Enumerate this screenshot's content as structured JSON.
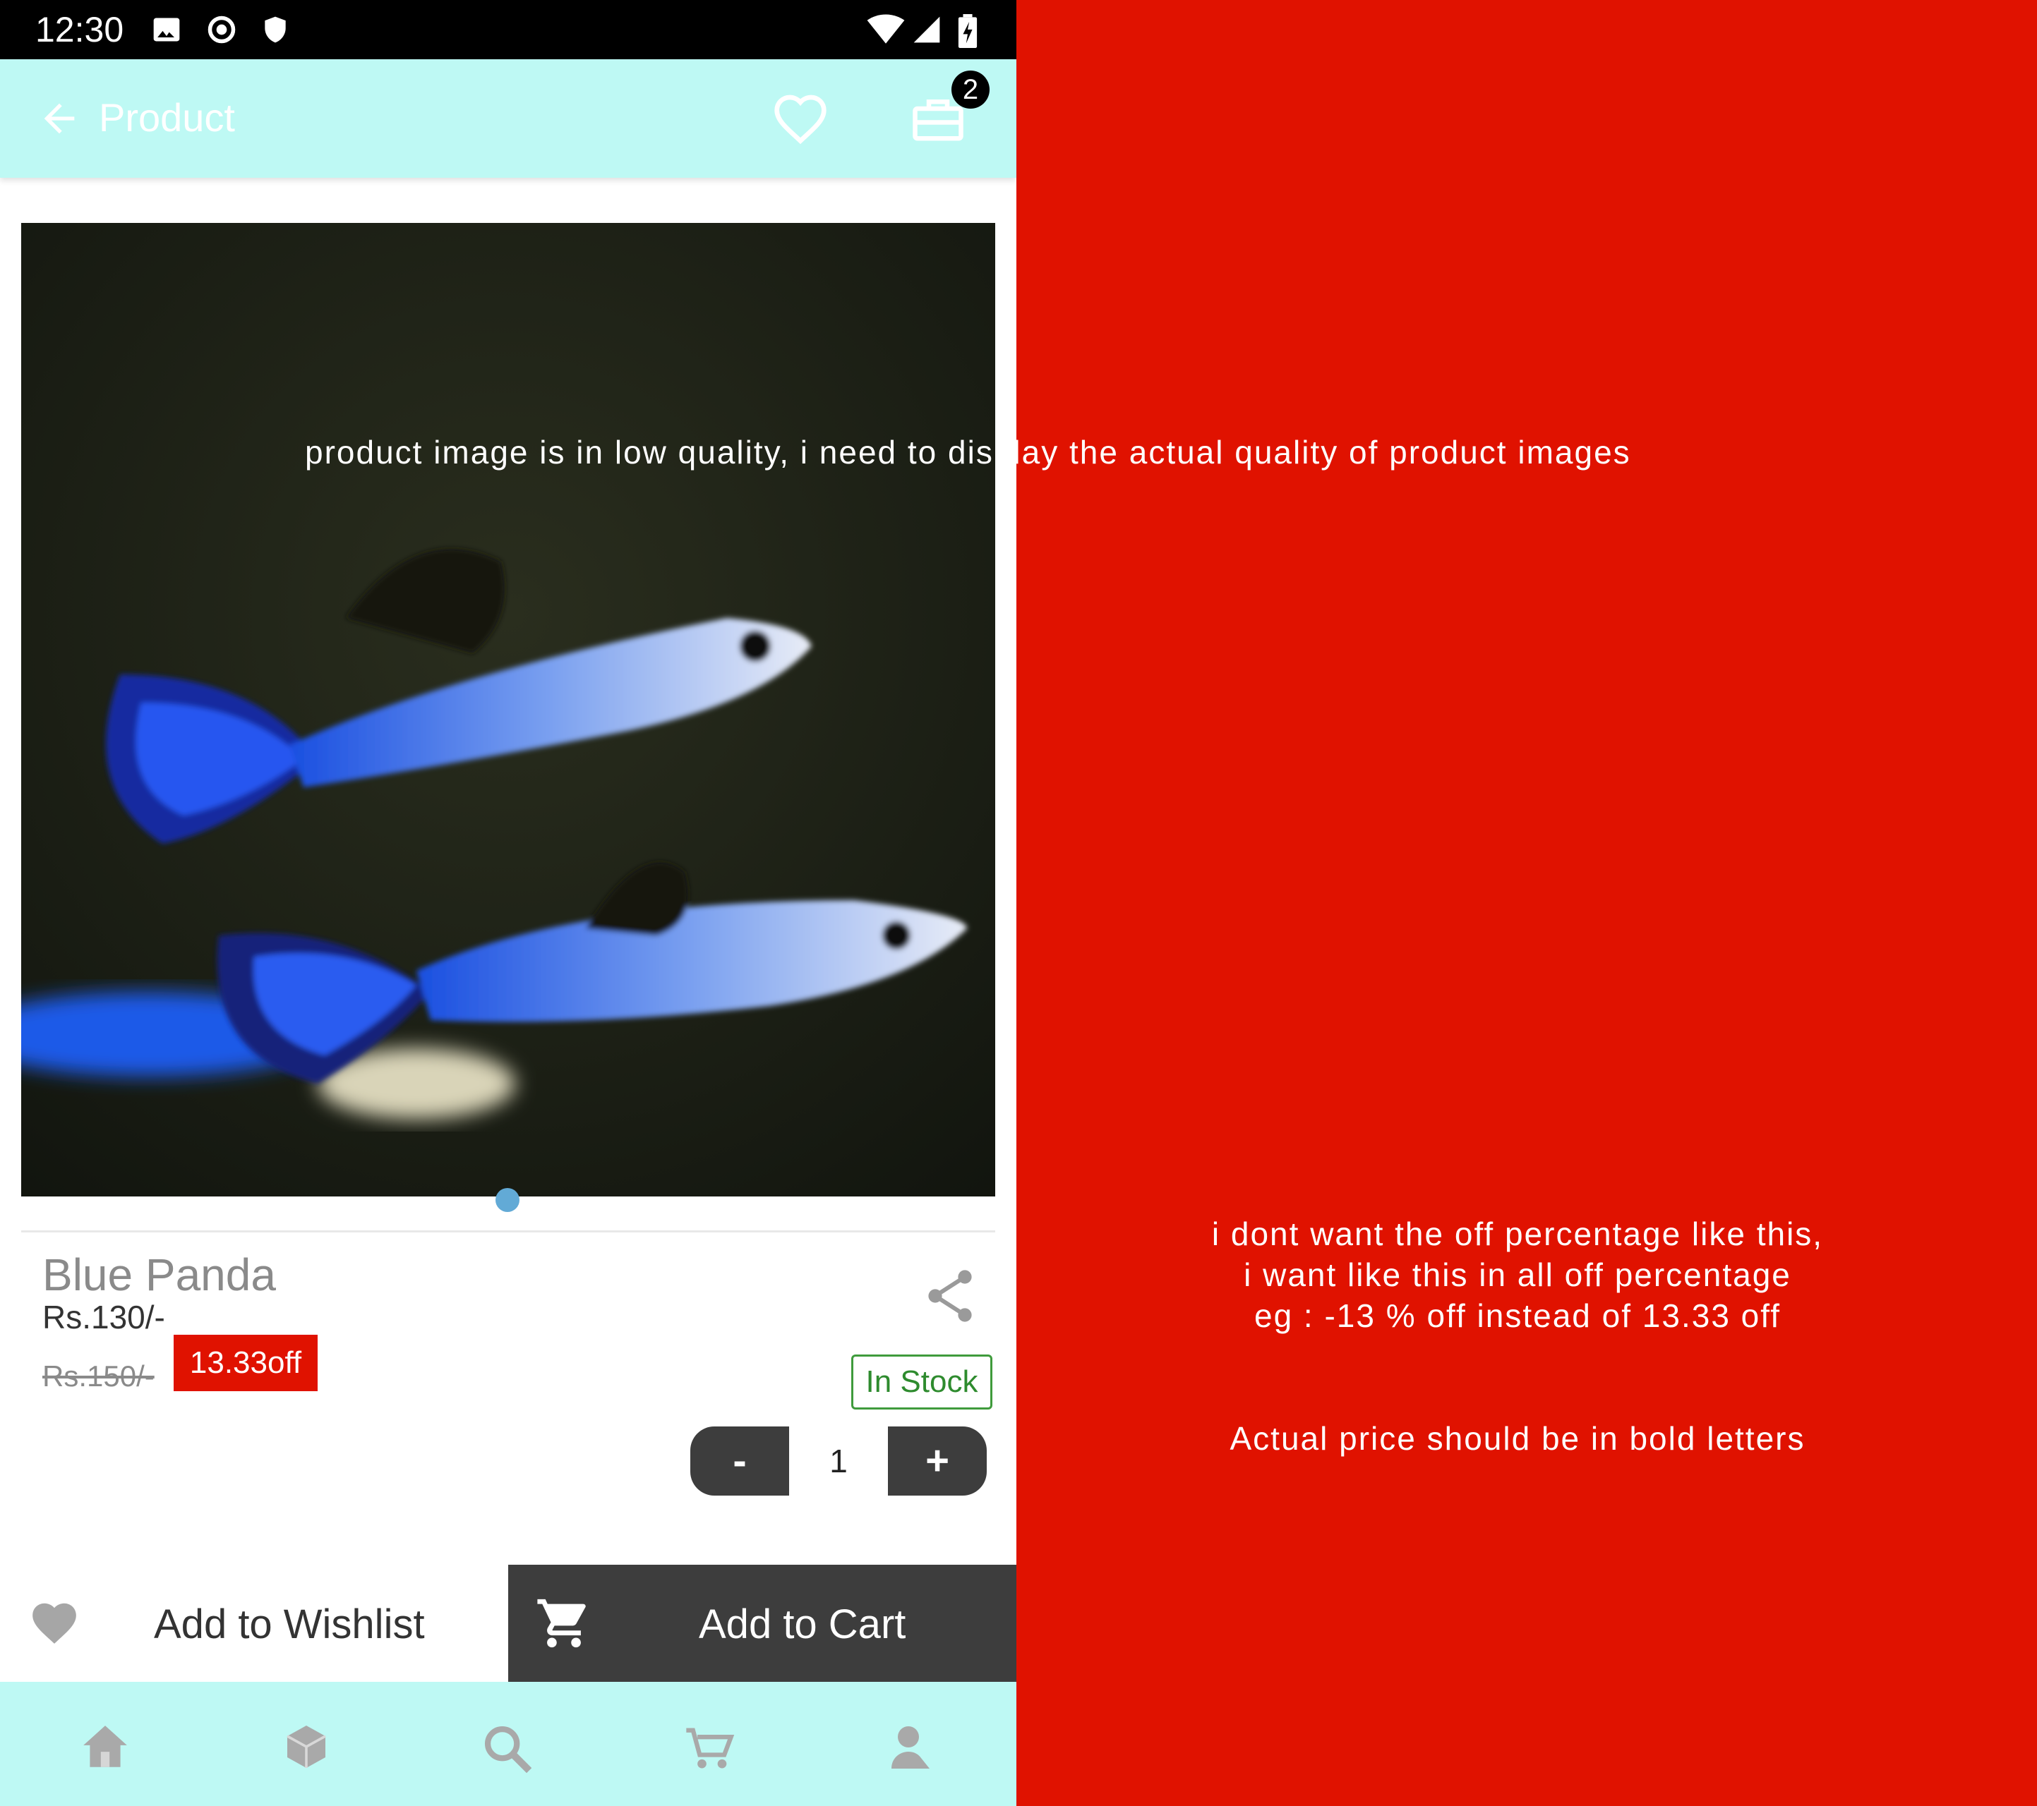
{
  "status_bar": {
    "time": "12:30"
  },
  "app_bar": {
    "title": "Product",
    "cart_badge": "2"
  },
  "product": {
    "name": "Blue Panda",
    "price": "Rs.130/-",
    "original_price": "Rs.150/-",
    "discount": "13.33off",
    "stock_status": "In Stock",
    "quantity": "1",
    "qty_minus": "-",
    "qty_plus": "+"
  },
  "actions": {
    "wishlist_label": "Add to Wishlist",
    "cart_label": "Add to Cart"
  },
  "bottom_nav": [
    "home-icon",
    "categories-icon",
    "search-icon",
    "cart-icon",
    "profile-icon"
  ],
  "annotations": {
    "image_note": "product image is in low quality, i need  to display the actual quality of product images",
    "discount_note": "i dont want the off percentage like this,\ni want like this in all off percentage\neg : -13 % off instead of 13.33 off",
    "price_note": "Actual price should be in bold letters"
  },
  "colors": {
    "accent_bar": "#bef9f4",
    "annotation_bg": "#e01200",
    "discount_badge": "#e01200",
    "stock_green": "#3f9b3c",
    "dark_button": "#3d3d3d"
  }
}
